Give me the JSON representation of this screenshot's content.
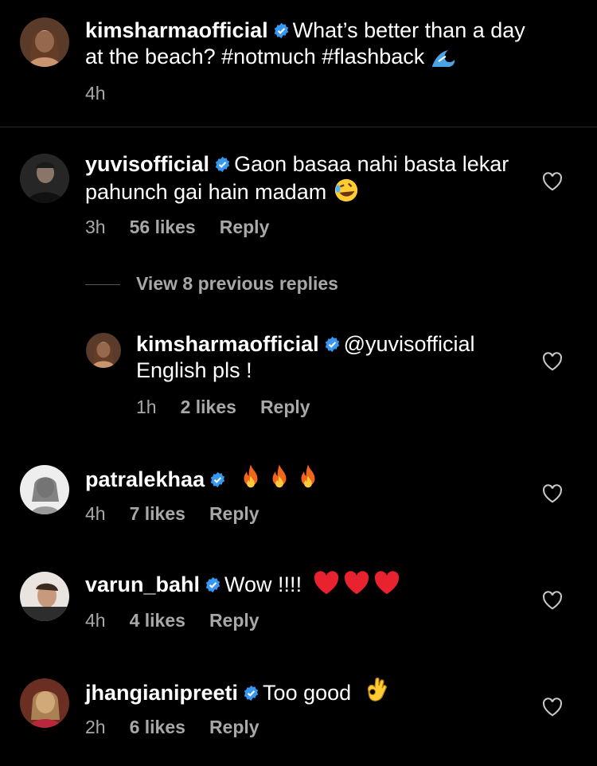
{
  "caption": {
    "username": "kimsharmaofficial",
    "text": "What’s better than a day at the beach? #notmuch #flashback",
    "time": "4h"
  },
  "comments": [
    {
      "username": "yuvisofficial",
      "text": "Gaon basaa nahi basta lekar pahunch gai hain madam",
      "time": "3h",
      "likes": "56 likes",
      "reply": "Reply"
    },
    {
      "username": "patralekhaa",
      "text": "",
      "time": "4h",
      "likes": "7 likes",
      "reply": "Reply"
    },
    {
      "username": "varun_bahl",
      "text": "Wow !!!!",
      "time": "4h",
      "likes": "4 likes",
      "reply": "Reply"
    },
    {
      "username": "jhangianipreeti",
      "text": "Too good",
      "time": "2h",
      "likes": "6 likes",
      "reply": "Reply"
    }
  ],
  "view_replies": "View 8 previous replies",
  "nested_reply": {
    "username": "kimsharmaofficial",
    "text": "@yuvisofficial English pls !",
    "time": "1h",
    "likes": "2 likes",
    "reply": "Reply"
  },
  "colors": {
    "background": "#000000",
    "verified": "#3897f0",
    "meta": "#a8a8a8"
  }
}
